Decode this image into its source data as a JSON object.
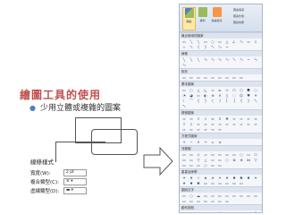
{
  "slide": {
    "title": "繪圖工具的使用",
    "bullet": "少用立體或複雜的圖案"
  },
  "line_style_panel": {
    "header": "線條樣式",
    "rows": [
      {
        "label": "寬度(W):",
        "value": "2 pt"
      },
      {
        "label": "複合類型(C):",
        "value": "≡ ▾"
      },
      {
        "label": "虛線類型(D):",
        "value": "▬ ▾"
      }
    ]
  },
  "ribbon": {
    "buttons": [
      {
        "label": "圖案"
      },
      {
        "label": "排列"
      },
      {
        "label": "快速樣式"
      }
    ],
    "side_menu": [
      "圖案填滿",
      "圖案外框",
      "圖案效果"
    ],
    "categories": [
      {
        "name": "最近使用的圖案",
        "icons": [
          "▭",
          "╲",
          "╲",
          "▭",
          "○",
          "▭",
          "△",
          "ㄥ",
          "ㄣ",
          "⇨",
          "⇩",
          "☆",
          "ㄟ",
          "{",
          "}",
          "ㄟ",
          "ㄣ",
          "~"
        ]
      },
      {
        "name": "線條",
        "icons": [
          "╲",
          "╲",
          "╲",
          "ㄣ",
          "ㄣ",
          "ㄣ",
          "ㄣ",
          "ㄟ",
          "ㄣ",
          "~",
          "ㄣ",
          "ㄣ"
        ]
      },
      {
        "name": "矩形",
        "icons": [
          "▭",
          "▭",
          "▭",
          "▭",
          "▭",
          "▭",
          "▭",
          "▭",
          "▭"
        ]
      },
      {
        "name": "基本圖案",
        "icons": [
          "▭",
          "○",
          "△",
          "◺",
          "▱",
          "⏢",
          "◇",
          "⬠",
          "⬡",
          "⯃",
          "○",
          "◔",
          "◕",
          "▭",
          "◐",
          "⊕",
          "✕",
          "▯",
          "◌",
          "☺",
          "♥",
          "☀",
          "☾",
          "⌒",
          "{",
          "}",
          "(",
          ")",
          "[",
          "]",
          "{",
          "}",
          "ㄟ",
          "ㄟ"
        ]
      },
      {
        "name": "箭號圖案",
        "icons": [
          "⇨",
          "⇦",
          "⇧",
          "⇩",
          "⇔",
          "⇕",
          "✥",
          "⇨",
          "⇨",
          "⇨",
          "⇦",
          "⇧",
          "⇩",
          "⇨",
          "⇨",
          "⇨",
          "⇦",
          "⇨",
          "⇨",
          "⇨",
          "⇨",
          "⇨",
          "⇨",
          "⇨",
          "⇨",
          "⇨",
          "⇨",
          "⇨"
        ]
      },
      {
        "name": "方程式圖案",
        "icons": [
          "+",
          "−",
          "×",
          "÷",
          "=",
          "≠"
        ]
      },
      {
        "name": "流程圖",
        "icons": [
          "▭",
          "▭",
          "◇",
          "▱",
          "▭",
          "▭",
          "▭",
          "▭",
          "○",
          "▭",
          "⬠",
          "▭",
          "▭",
          "▽",
          "△",
          "▭",
          "▭",
          "○",
          "⊗",
          "⊕",
          "⋈",
          "▽",
          "▭",
          "▭",
          "▭",
          "○",
          "▭",
          "▭"
        ]
      },
      {
        "name": "星星及綵帶",
        "icons": [
          "✶",
          "✷",
          "☆",
          "★",
          "✯",
          "✶",
          "✷",
          "✹",
          "✺",
          "✸",
          "✶",
          "✷",
          "✹",
          "✺",
          "▭",
          "▭",
          "▭",
          "▭",
          "▭",
          "▭"
        ]
      },
      {
        "name": "圖說文字",
        "icons": [
          "▭",
          "○",
          "☁",
          "▭",
          "▭",
          "▭",
          "▭",
          "▭",
          "▭",
          "▭",
          "▭",
          "▭",
          "▭",
          "▭",
          "▭",
          "▭",
          "▭",
          "▭"
        ]
      },
      {
        "name": "動作按鈕",
        "icons": [
          "◁",
          "▷",
          "⏮",
          "⏭",
          "⌂",
          "ⓘ",
          "↩",
          "▦",
          "▭",
          "▶",
          "?",
          "▭"
        ]
      }
    ]
  },
  "colors": {
    "title": "#c0504d",
    "bullet_dot": "#4f81bd",
    "ribbon_border": "#aab6c8",
    "ribbon_bg": "#f4f6fa",
    "category_header_bg": "#dde4ef",
    "selected_button_bg": "#ffe9a8"
  }
}
